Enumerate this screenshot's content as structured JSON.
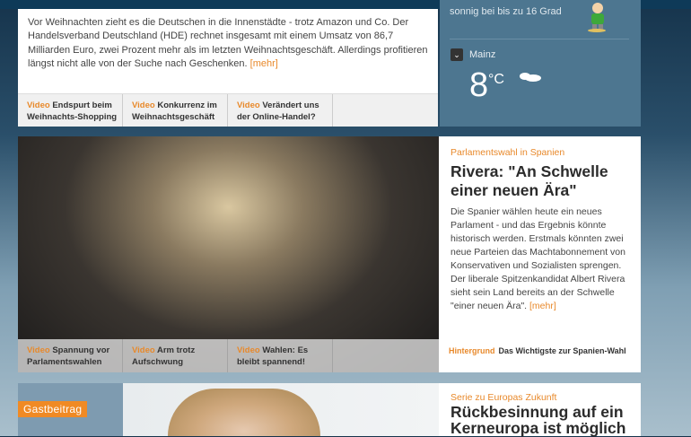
{
  "article1": {
    "body": "Vor Weihnachten zieht es die Deutschen in die Innenstädte - trotz Amazon und Co. Der Handelsverband Deutschland (HDE) rechnet insgesamt mit einem Umsatz von 86,7 Milliarden Euro, zwei Prozent mehr als im letzten Weihnachtsgeschäft. Allerdings profitieren längst nicht alle von der Suche nach Geschenken.",
    "more": "[mehr]",
    "videos": [
      {
        "label": "Video",
        "title": "Endspurt beim Weihnachts-Shopping"
      },
      {
        "label": "Video",
        "title": "Konkurrenz im Weihnachtsgeschäft"
      },
      {
        "label": "Video",
        "title": "Verändert uns der Online-Handel?"
      }
    ]
  },
  "weather": {
    "forecast_text": "sonnig bei bis zu 16 Grad",
    "city": "Mainz",
    "temperature": "8",
    "unit": "°C",
    "icon": "cloud-icon"
  },
  "article2": {
    "kicker": "Parlamentswahl in Spanien",
    "headline": "Rivera: \"An Schwelle einer neuen Ära\"",
    "body": "Die Spanier wählen heute ein neues Parlament - und das Ergebnis könnte historisch werden. Erstmals könnten zwei neue Parteien das Machtabonnement von Konservativen und Sozialisten sprengen. Der liberale Spitzenkandidat Albert Rivera sieht sein Land bereits an der Schwelle \"einer neuen Ära\".",
    "more": "[mehr]",
    "background_label": "Hintergrund",
    "background_title": "Das Wichtigste zur Spanien-Wahl",
    "videos": [
      {
        "label": "Video",
        "title": "Spannung vor Parlamentswahlen"
      },
      {
        "label": "Video",
        "title": "Arm trotz Aufschwung"
      },
      {
        "label": "Video",
        "title": "Wahlen: Es bleibt spannend!"
      }
    ]
  },
  "article3": {
    "badge": "Gastbeitrag",
    "kicker": "Serie zu Europas Zukunft",
    "headline": "Rückbesinnung auf ein Kerneuropa ist möglich"
  },
  "colors": {
    "accent": "#e8892b",
    "weather_bg": "#4d7690"
  }
}
